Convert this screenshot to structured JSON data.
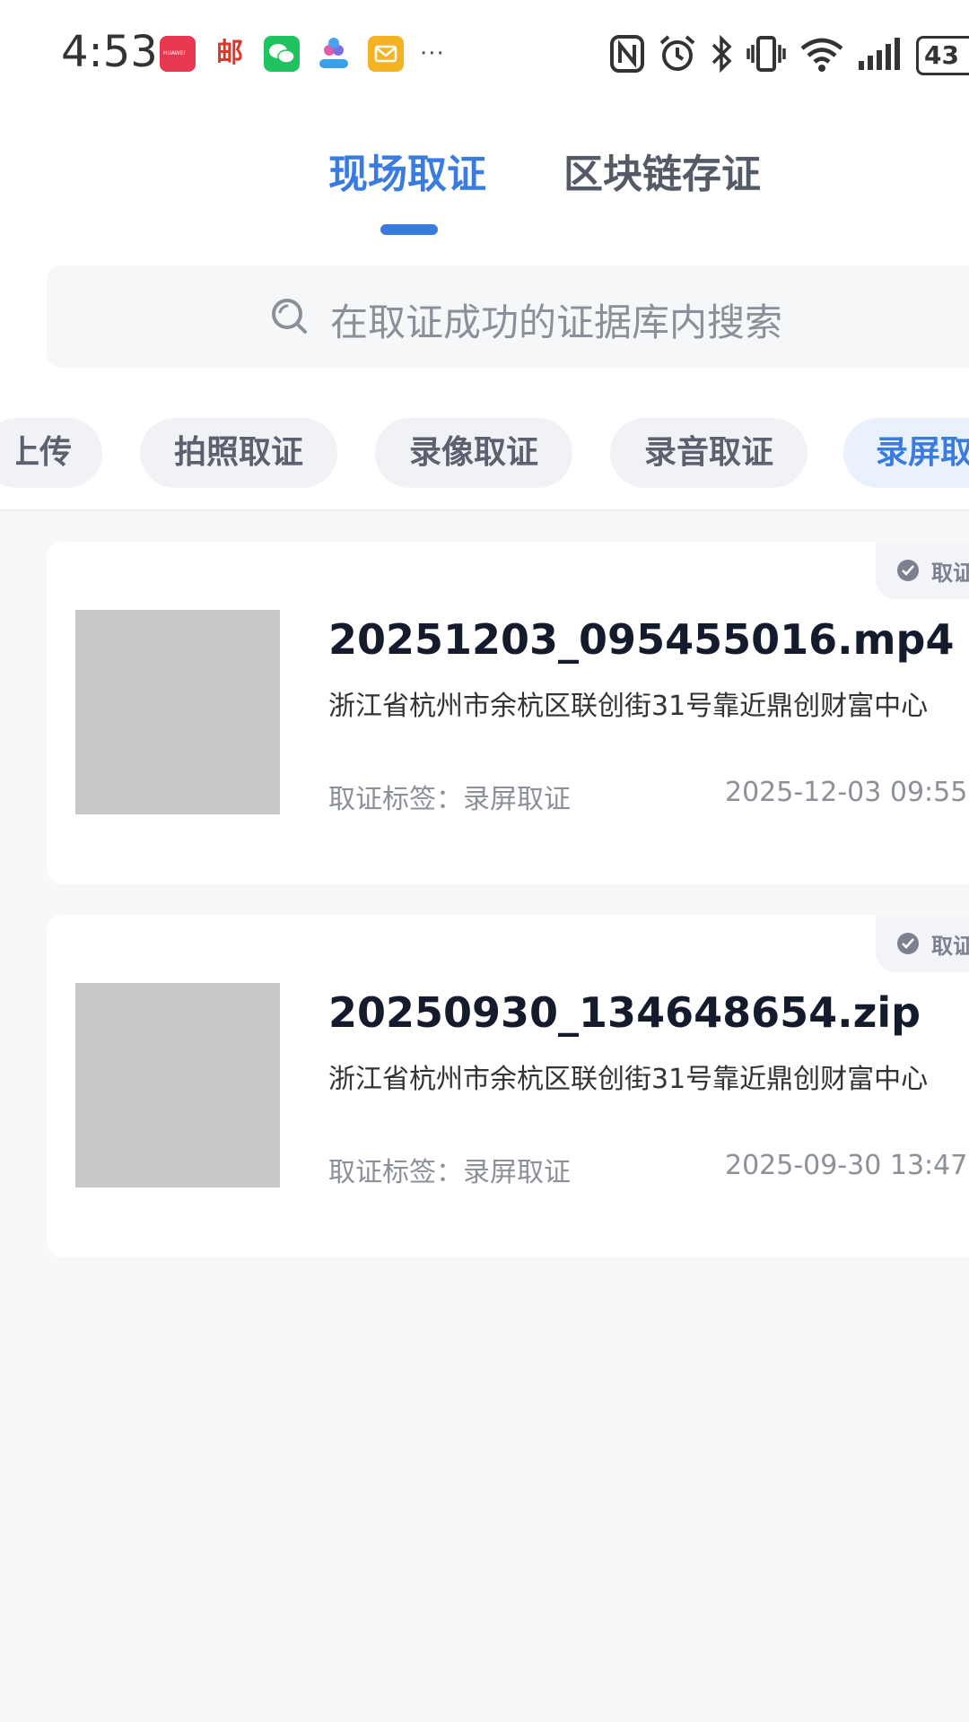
{
  "status_bar": {
    "time": "4:53",
    "notification_icons": [
      "huawei-appgallery-icon",
      "china-post-icon",
      "wechat-icon",
      "genflow-icon",
      "mail-icon",
      "more-icon"
    ],
    "huawei_label": "HUAWEI",
    "post_glyph": "邮",
    "more_glyph": "···",
    "battery": "43"
  },
  "tabs": [
    {
      "label": "现场取证",
      "active": true
    },
    {
      "label": "区块链存证",
      "active": false
    }
  ],
  "search": {
    "placeholder": "在取证成功的证据库内搜索"
  },
  "filters": [
    {
      "label": "上传"
    },
    {
      "label": "拍照取证"
    },
    {
      "label": "录像取证"
    },
    {
      "label": "录音取证"
    },
    {
      "label": "录屏取证",
      "selected": true
    }
  ],
  "records": [
    {
      "file_name": "20251203_095455016.mp4",
      "location": "浙江省杭州市余杭区联创街31号靠近鼎创财富中心",
      "tag_label": "取证标签：",
      "tag_value": "录屏取证",
      "timestamp": "2025-12-03 09:55",
      "status": "取证成功"
    },
    {
      "file_name": "20250930_134648654.zip",
      "location": "浙江省杭州市余杭区联创街31号靠近鼎创财富中心",
      "tag_label": "取证标签：",
      "tag_value": "录屏取证",
      "timestamp": "2025-09-30 13:47",
      "status": "取证成功"
    }
  ],
  "colors": {
    "accent": "#3a7be0",
    "background": "#f8f8f9",
    "thumbnail_placeholder": "#c8c8c8"
  }
}
